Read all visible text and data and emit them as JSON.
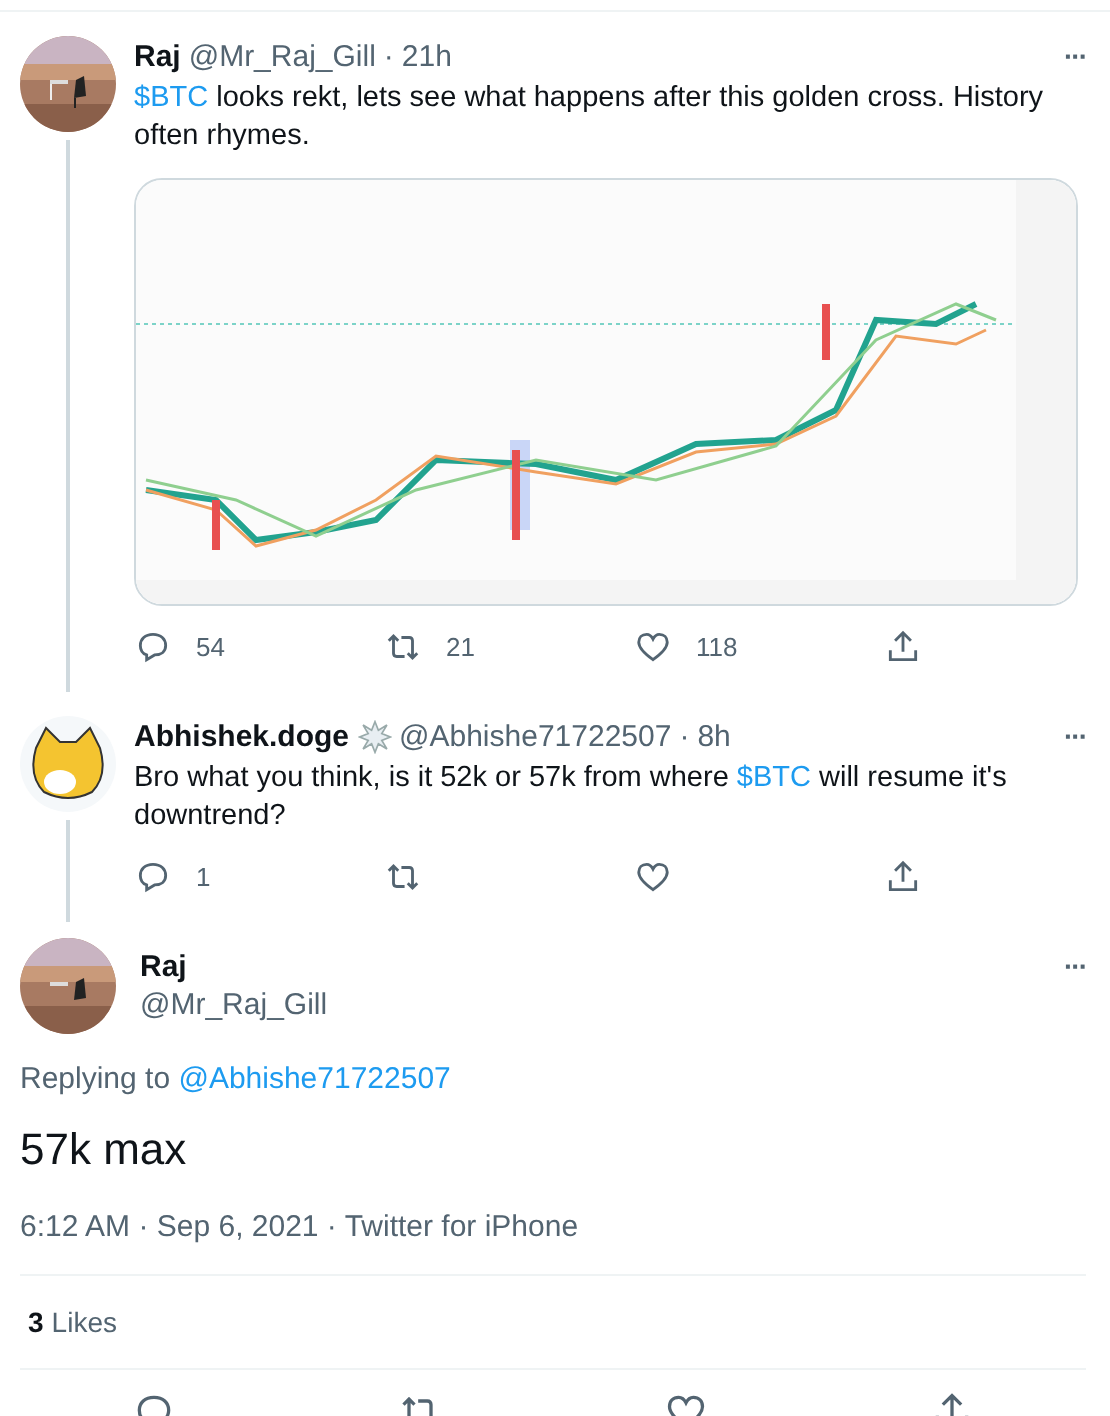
{
  "thread": [
    {
      "name": "Raj",
      "handle": "@Mr_Raj_Gill",
      "dot": "·",
      "time": "21h",
      "avatar": {
        "kind": "picture"
      },
      "badge": false,
      "text": [
        {
          "text": "$BTC",
          "link": true
        },
        {
          "text": " looks rekt, lets see what happens after this golden cross. History often rhymes.",
          "link": false
        }
      ],
      "media": {
        "kind": "picture"
      },
      "more": "···",
      "actions": [
        {
          "kind": "reply",
          "count": "54"
        },
        {
          "kind": "retweet",
          "count": "21"
        },
        {
          "kind": "like",
          "count": "118"
        },
        {
          "kind": "share"
        }
      ]
    },
    {
      "name": "Abhishek.doge",
      "handle": "@Abhishe71722507",
      "dot": "·",
      "time": "8h",
      "avatar": {
        "kind": "icon"
      },
      "badge": true,
      "text": [
        {
          "text": "Bro what you think, is it 52k or 57k from where ",
          "link": false
        },
        {
          "text": "$BTC",
          "link": true
        },
        {
          "text": " will resume it's downtrend?",
          "link": false
        }
      ],
      "more": "···",
      "actions": [
        {
          "kind": "reply",
          "count": "1"
        },
        {
          "kind": "retweet"
        },
        {
          "kind": "like"
        },
        {
          "kind": "share"
        }
      ]
    }
  ],
  "focus": {
    "name": "Raj",
    "handle": "@Mr_Raj_Gill",
    "avatar": {
      "kind": "picture"
    },
    "more": "···",
    "replying_label": "Replying to",
    "replying_to": "@Abhishe71722507",
    "text": "57k max",
    "timestamp": "6:12 AM · Sep 6, 2021 · Twitter for iPhone",
    "likes_count": "3",
    "likes_label": "Likes",
    "actions": [
      {
        "kind": "reply"
      },
      {
        "kind": "retweet"
      },
      {
        "kind": "like"
      },
      {
        "kind": "share"
      }
    ]
  }
}
